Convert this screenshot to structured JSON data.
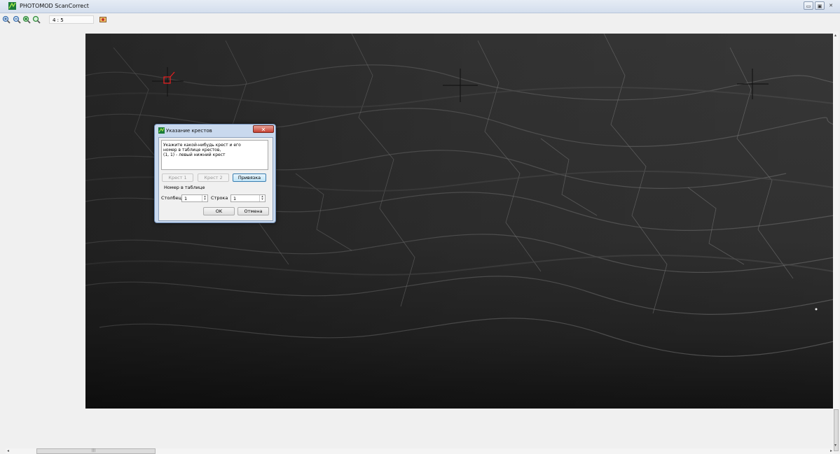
{
  "window": {
    "title": "PHOTOMOD ScanCorrect",
    "minimize_glyph": "▭",
    "maximize_glyph": "▣",
    "close_glyph": "✕"
  },
  "toolbar": {
    "zoom_value": "4 : 5",
    "icons": [
      "zoom-in-icon",
      "zoom-out-icon",
      "zoom-fit-icon",
      "zoom-actual-icon",
      "image-settings-icon"
    ]
  },
  "dialog": {
    "title": "Указание крестов",
    "close_glyph": "✕",
    "message": "Укажите какой-нибудь крест и его\nномер в таблице крестов,\n(1, 1) - левый нижний крест",
    "cross1_label": "Крест 1",
    "cross2_label": "Крест 2",
    "bind_label": "Привязка",
    "table_number_label": "Номер в таблице",
    "column_label": "Столбец",
    "column_value": "1",
    "row_label": "Строка",
    "row_value": "1",
    "ok_label": "OK",
    "cancel_label": "Отмена"
  },
  "scrollbars": {
    "h_thumb_glyph": "|||"
  },
  "colors": {
    "accent": "#3c7fb1",
    "marker": "#e02020",
    "image_bg": "#2b2b2b"
  }
}
